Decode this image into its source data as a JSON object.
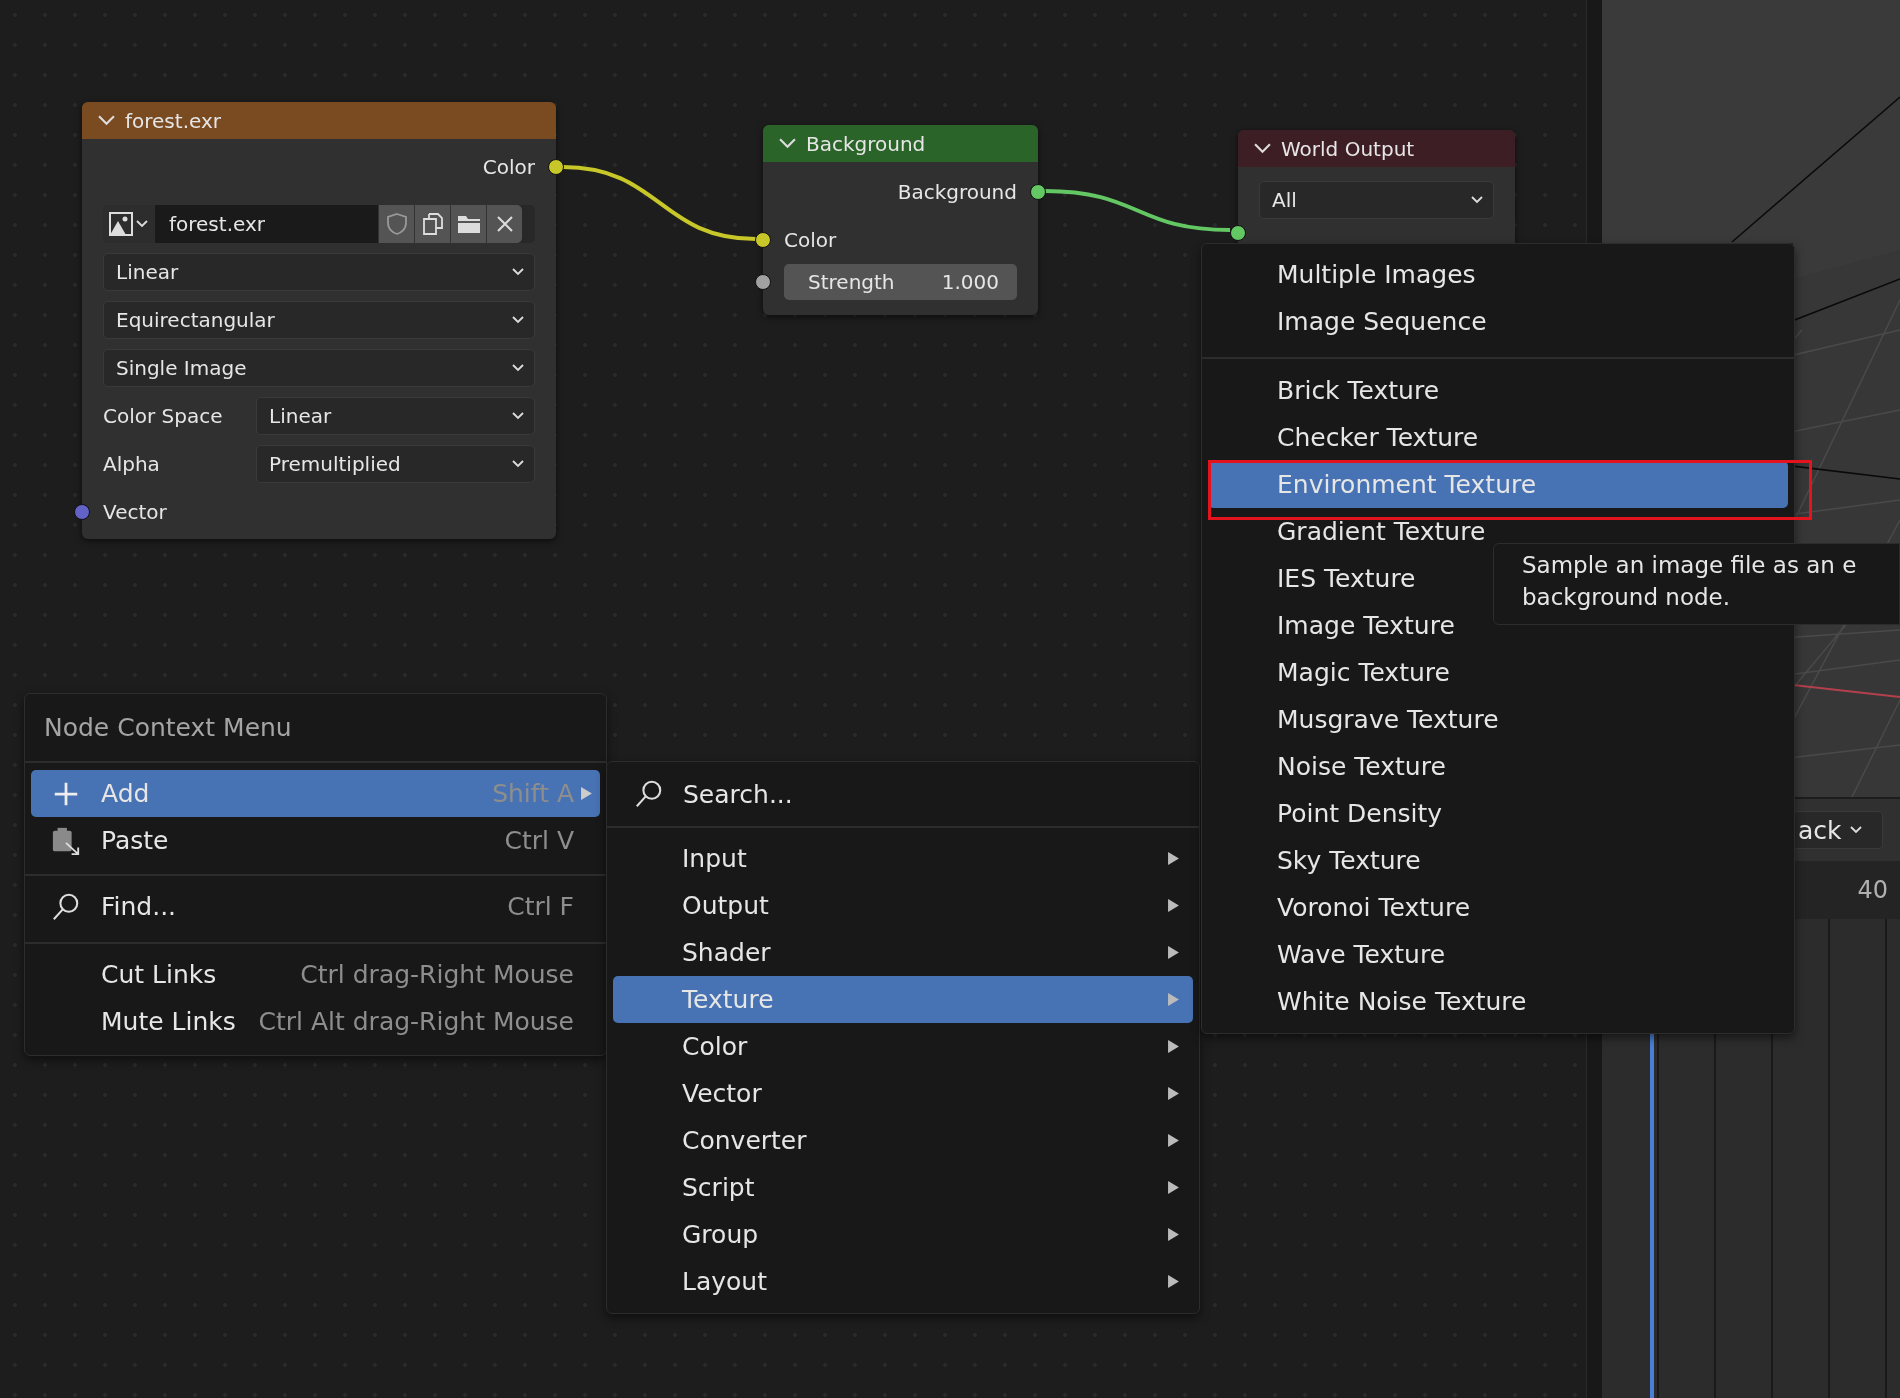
{
  "image_node": {
    "kind": "texture",
    "title": "forest.exr",
    "outputs": [
      {
        "label": "Color",
        "color": "#c7c729"
      }
    ],
    "image": {
      "value": "forest.exr"
    },
    "dropdowns": [
      {
        "value": "Linear"
      },
      {
        "value": "Equirectangular"
      },
      {
        "value": "Single Image"
      }
    ],
    "properties": [
      {
        "label": "Color Space",
        "value": "Linear"
      },
      {
        "label": "Alpha",
        "value": "Premultiplied"
      }
    ],
    "inputs": [
      {
        "label": "Vector",
        "color": "#6363c7"
      }
    ]
  },
  "background_node": {
    "kind": "shader",
    "title": "Background",
    "outputs": [
      {
        "label": "Background",
        "color": "#63c763"
      }
    ],
    "inputs": [
      {
        "kind": "socket",
        "label": "Color",
        "color": "#c7c729"
      },
      {
        "kind": "field",
        "label": "Strength",
        "value": "1.000",
        "color": "#a1a1a1"
      }
    ]
  },
  "output_node": {
    "kind": "output",
    "title": "World Output",
    "dropdown": {
      "value": "All"
    },
    "inputs": [
      {
        "color": "#63c763"
      }
    ]
  },
  "context_menu": {
    "title": "Node Context Menu",
    "sections": [
      {
        "items": [
          {
            "label": "Add",
            "shortcut": "Shift A",
            "submenu": true,
            "selected": true
          },
          {
            "label": "Paste",
            "shortcut": "Ctrl V",
            "submenu": false,
            "selected": false
          }
        ]
      },
      {
        "items": [
          {
            "label": "Find...",
            "shortcut": "Ctrl F",
            "submenu": false,
            "selected": false
          }
        ]
      },
      {
        "items": [
          {
            "label": "Cut Links",
            "shortcut": "Ctrl drag-Right Mouse",
            "submenu": false,
            "selected": false
          },
          {
            "label": "Mute Links",
            "shortcut": "Ctrl Alt drag-Right Mouse",
            "submenu": false,
            "selected": false
          }
        ]
      }
    ]
  },
  "add_menu": {
    "search": {
      "placeholder": "Search..."
    },
    "items": [
      {
        "label": "Input",
        "submenu": true,
        "selected": false
      },
      {
        "label": "Output",
        "submenu": true,
        "selected": false
      },
      {
        "label": "Shader",
        "submenu": true,
        "selected": false
      },
      {
        "label": "Texture",
        "submenu": true,
        "selected": true
      },
      {
        "label": "Color",
        "submenu": true,
        "selected": false
      },
      {
        "label": "Vector",
        "submenu": true,
        "selected": false
      },
      {
        "label": "Converter",
        "submenu": true,
        "selected": false
      },
      {
        "label": "Script",
        "submenu": true,
        "selected": false
      },
      {
        "label": "Group",
        "submenu": true,
        "selected": false
      },
      {
        "label": "Layout",
        "submenu": true,
        "selected": false
      }
    ]
  },
  "texture_menu": {
    "sections": [
      {
        "items": [
          {
            "label": "Multiple Images",
            "selected": false
          },
          {
            "label": "Image Sequence",
            "selected": false
          }
        ]
      },
      {
        "items": [
          {
            "label": "Brick Texture",
            "selected": false
          },
          {
            "label": "Checker Texture",
            "selected": false
          },
          {
            "label": "Environment Texture",
            "selected": true
          },
          {
            "label": "Gradient Texture",
            "selected": false
          },
          {
            "label": "IES Texture",
            "selected": false
          },
          {
            "label": "Image Texture",
            "selected": false
          },
          {
            "label": "Magic Texture",
            "selected": false
          },
          {
            "label": "Musgrave Texture",
            "selected": false
          },
          {
            "label": "Noise Texture",
            "selected": false
          },
          {
            "label": "Point Density",
            "selected": false
          },
          {
            "label": "Sky Texture",
            "selected": false
          },
          {
            "label": "Voronoi Texture",
            "selected": false
          },
          {
            "label": "Wave Texture",
            "selected": false
          },
          {
            "label": "White Noise Texture",
            "selected": false
          }
        ]
      }
    ]
  },
  "tooltip": {
    "lines": [
      "Sample an image file as an e",
      "background node."
    ]
  },
  "timeline": {
    "dropdown": {
      "value": "ack"
    },
    "frame": "40"
  }
}
